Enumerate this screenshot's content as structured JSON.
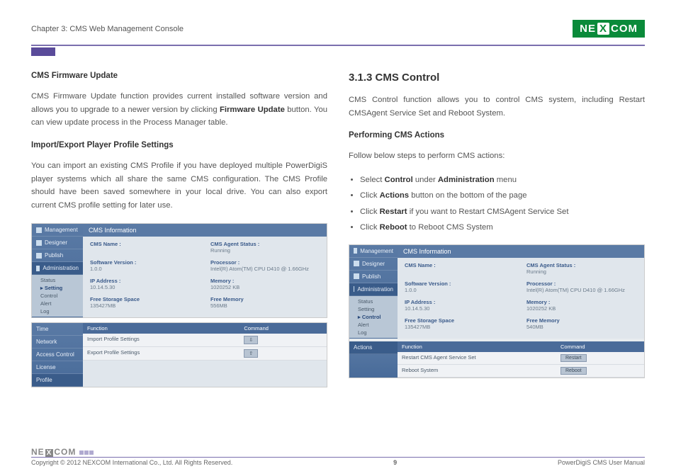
{
  "header": {
    "chapter": "Chapter 3: CMS Web Management Console",
    "logo_pre": "NE",
    "logo_x": "X",
    "logo_post": "COM"
  },
  "left": {
    "h1": "CMS Firmware Update",
    "p1a": "CMS Firmware Update function provides current installed software version and allows you to upgrade to a newer version by clicking ",
    "p1b": "Firmware Update",
    "p1c": " button. You can view update process in the Process Manager table.",
    "h2": "Import/Export Player Profile Settings",
    "p2": "You can import an existing CMS Profile if you have deployed multiple PowerDigiS player systems which all share the same CMS configuration. The CMS Profile should have been saved somewhere in your local drive. You can also export current CMS profile setting for later use."
  },
  "right": {
    "title": "3.1.3 CMS Control",
    "p1": "CMS Control function allows you to control CMS system, including Restart CMSAgent Service Set and Reboot System.",
    "h1": "Performing CMS Actions",
    "p2": "Follow below steps to perform CMS actions:",
    "b1a": "Select ",
    "b1b": "Control",
    "b1c": " under ",
    "b1d": "Administration",
    "b1e": " menu",
    "b2a": "Click ",
    "b2b": "Actions",
    "b2c": " button on the bottom of the page",
    "b3a": "Click ",
    "b3b": "Restart",
    "b3c": " if you want to Restart CMSAgent Service Set",
    "b4a": "Click ",
    "b4b": "Reboot",
    "b4c": " to Reboot CMS System"
  },
  "shot1": {
    "side": [
      "Management",
      "Designer",
      "Publish",
      "Administration"
    ],
    "sub": [
      "Status",
      "▸ Setting",
      "Control",
      "Alert",
      "Log"
    ],
    "title": "CMS Information",
    "rows": [
      {
        "l": "CMS Name :",
        "v": "",
        "l2": "CMS Agent Status :",
        "v2": "Running"
      },
      {
        "l": "Software Version :",
        "v": "1.0.0",
        "l2": "Processor :",
        "v2": "Intel(R) Atom(TM) CPU D410 @ 1.66GHz"
      },
      {
        "l": "IP Address :",
        "v": "10.14.5.30",
        "l2": "Memory :",
        "v2": "1020252 KB"
      },
      {
        "l": "Free Storage Space",
        "v": "135427MB",
        "l2": "Free Memory",
        "v2": "556MB"
      }
    ]
  },
  "shot1b": {
    "side": [
      "Time",
      "Network",
      "Access Control",
      "License",
      "Profile"
    ],
    "h1": "Function",
    "h2": "Command",
    "rows": [
      [
        "Import Profile Settings",
        ""
      ],
      [
        "Export Profile Settings",
        ""
      ]
    ]
  },
  "shot2": {
    "side": [
      "Management",
      "Designer",
      "Publish",
      "Administration"
    ],
    "sub": [
      "Status",
      "Setting",
      "▸ Control",
      "Alert",
      "Log"
    ],
    "title": "CMS Information",
    "rows": [
      {
        "l": "CMS Name :",
        "v": "",
        "l2": "CMS Agent Status :",
        "v2": "Running"
      },
      {
        "l": "Software Version :",
        "v": "1.0.0",
        "l2": "Processor :",
        "v2": "Intel(R) Atom(TM) CPU D410 @ 1.66GHz"
      },
      {
        "l": "IP Address :",
        "v": "10.14.5.30",
        "l2": "Memory :",
        "v2": "1020252 KB"
      },
      {
        "l": "Free Storage Space",
        "v": "135427MB",
        "l2": "Free Memory",
        "v2": "540MB"
      }
    ],
    "act_h": "Actions",
    "fh1": "Function",
    "fh2": "Command",
    "arows": [
      [
        "Restart CMS Agent Service Set",
        "Restart"
      ],
      [
        "Reboot System",
        "Reboot"
      ]
    ]
  },
  "footer": {
    "copy": "Copyright © 2012 NEXCOM International Co., Ltd. All Rights Reserved.",
    "page": "9",
    "manual": "PowerDigiS CMS User Manual"
  }
}
